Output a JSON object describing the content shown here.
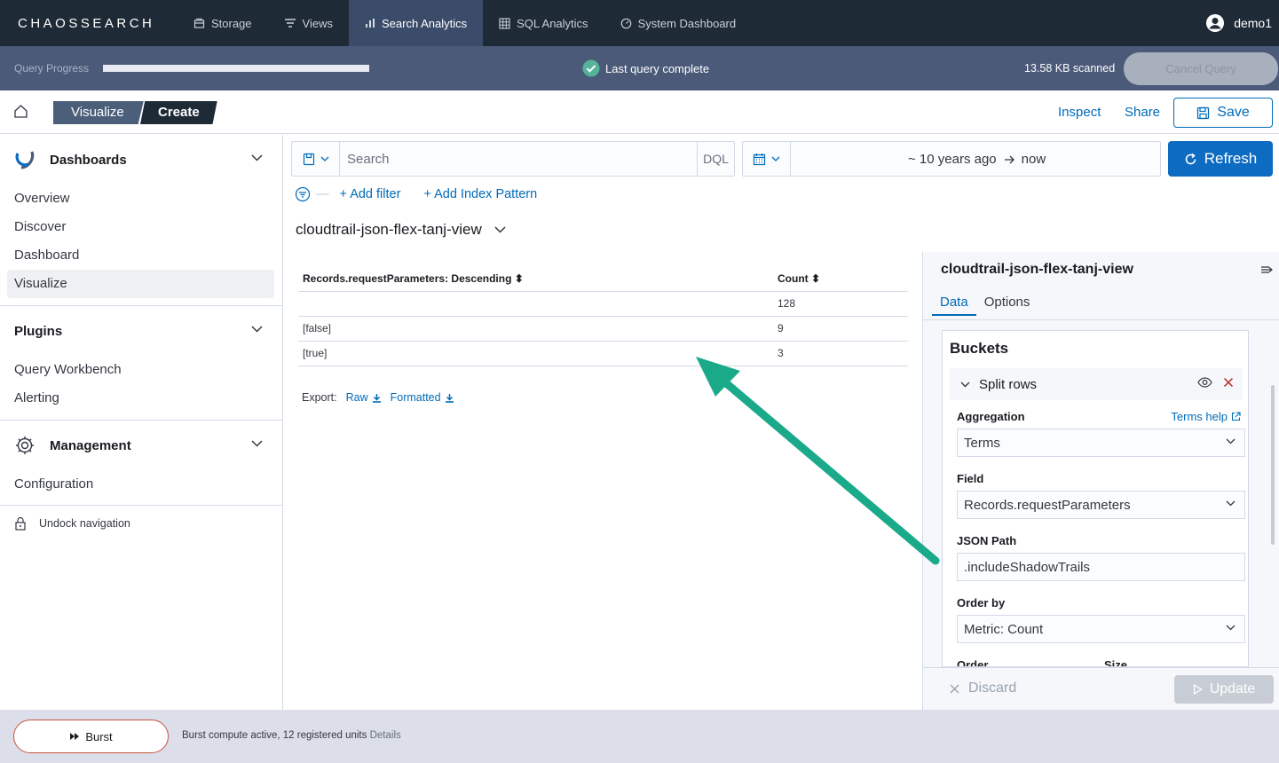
{
  "topnav": {
    "logo": "CHAOSSEARCH",
    "tabs": [
      {
        "label": "Storage",
        "icon": "storage-icon"
      },
      {
        "label": "Views",
        "icon": "views-icon"
      },
      {
        "label": "Search Analytics",
        "icon": "bar-chart-icon",
        "active": true
      },
      {
        "label": "SQL Analytics",
        "icon": "table-icon"
      },
      {
        "label": "System Dashboard",
        "icon": "dashboard-icon"
      }
    ],
    "user": "demo1"
  },
  "query_progress": {
    "label": "Query Progress",
    "progress": 1.0,
    "status": "Last query complete",
    "scanned": "13.58 KB scanned",
    "cancel_label": "Cancel Query"
  },
  "header": {
    "breadcrumbs": [
      "Visualize",
      "Create"
    ],
    "inspect": "Inspect",
    "share": "Share",
    "save": "Save"
  },
  "sidebar": {
    "groups": [
      {
        "title": "Dashboards",
        "items": [
          "Overview",
          "Discover",
          "Dashboard",
          "Visualize"
        ],
        "selected": "Visualize"
      },
      {
        "title": "Plugins",
        "items": [
          "Query Workbench",
          "Alerting"
        ]
      },
      {
        "title": "Management",
        "items": [
          "Configuration"
        ]
      }
    ],
    "undock": "Undock navigation"
  },
  "query": {
    "search_placeholder": "Search",
    "language": "DQL",
    "date_start": "~ 10 years ago",
    "date_end": "now",
    "refresh": "Refresh",
    "add_filter": "+ Add filter",
    "add_index_pattern": "+ Add Index Pattern",
    "index_pattern": "cloudtrail-json-flex-tanj-view"
  },
  "table": {
    "columns": [
      "Records.requestParameters: Descending",
      "Count"
    ],
    "rows": [
      [
        "",
        "128"
      ],
      [
        "[false]",
        "9"
      ],
      [
        "[true]",
        "3"
      ]
    ],
    "export_label": "Export:",
    "export_raw": "Raw",
    "export_formatted": "Formatted"
  },
  "editor": {
    "title": "cloudtrail-json-flex-tanj-view",
    "tabs": [
      "Data",
      "Options"
    ],
    "buckets_title": "Buckets",
    "split_label": "Split rows",
    "aggregation_label": "Aggregation",
    "terms_help": "Terms help",
    "aggregation_value": "Terms",
    "field_label": "Field",
    "field_value": "Records.requestParameters",
    "json_path_label": "JSON Path",
    "json_path_value": ".includeShadowTrails",
    "order_by_label": "Order by",
    "order_by_value": "Metric: Count",
    "order_label": "Order",
    "size_label": "Size",
    "discard": "Discard",
    "update": "Update"
  },
  "bottom": {
    "burst_label": "Burst",
    "status": "Burst compute active, 12 registered units",
    "details": "Details"
  },
  "colors": {
    "nav_bg": "#1f2a37",
    "progress_bg": "#4b5a79",
    "primary": "#0d6bc2",
    "link": "#006bb8",
    "annotation_arrow": "#1aaa8a"
  }
}
